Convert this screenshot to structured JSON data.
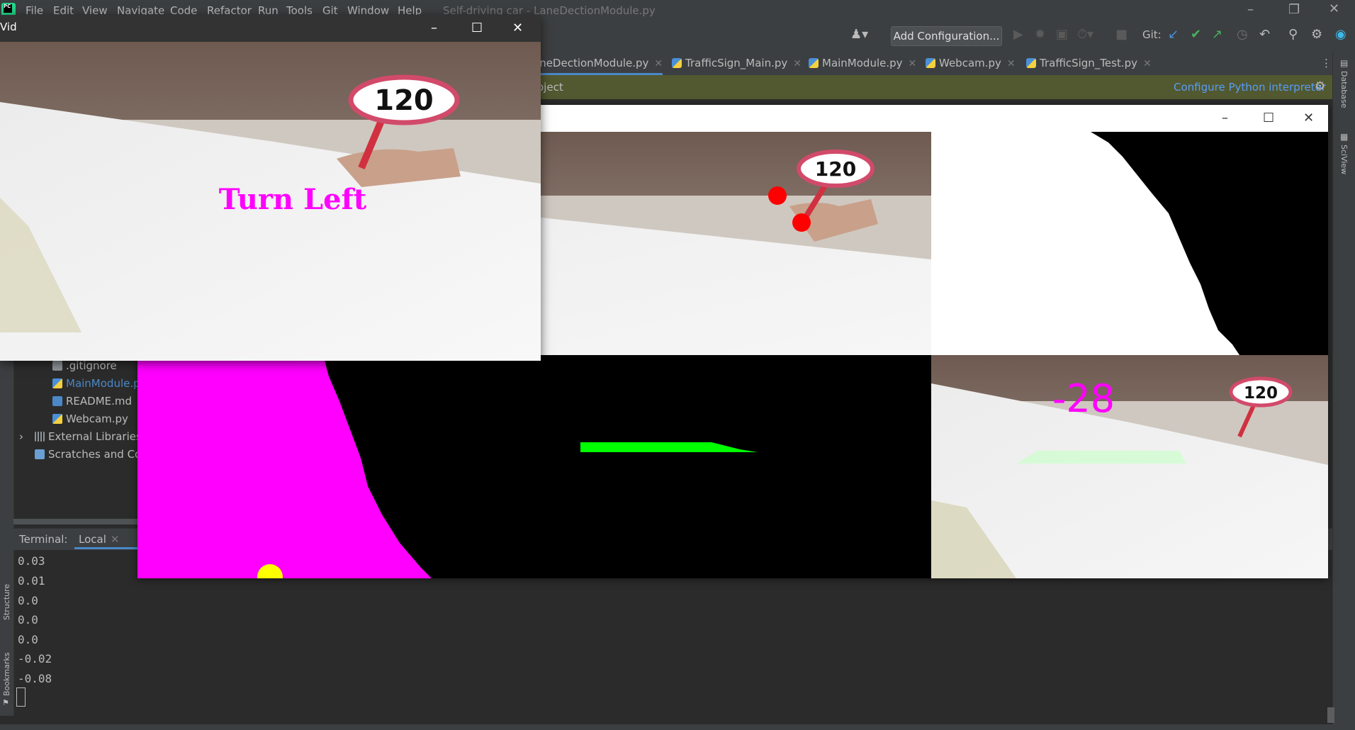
{
  "ide": {
    "logo_text": "PC",
    "menu": [
      "File",
      "Edit",
      "View",
      "Navigate",
      "Code",
      "Refactor",
      "Run",
      "Tools",
      "Git",
      "Window",
      "Help"
    ],
    "title": "Self-driving car - LaneDectionModule.py",
    "window_controls": [
      "minimize-icon",
      "restore-icon",
      "close-icon"
    ]
  },
  "toolbar": {
    "add_config_label": "Add Configuration...",
    "git_label": "Git:"
  },
  "tabs": [
    {
      "label": "aneDectionModule.py",
      "active": true
    },
    {
      "label": "TrafficSign_Main.py",
      "active": false
    },
    {
      "label": "MainModule.py",
      "active": false
    },
    {
      "label": "Webcam.py",
      "active": false
    },
    {
      "label": "TrafficSign_Test.py",
      "active": false
    }
  ],
  "notice": {
    "left_text": "oject",
    "configure_label": "Configure Python interpreter"
  },
  "right_strip": {
    "labels": [
      "Database",
      "SciView"
    ]
  },
  "left_strip": {
    "labels": [
      "Structure",
      "Bookmarks"
    ]
  },
  "project_tree": [
    {
      "label": ".gitignore",
      "icon": "text-file-icon"
    },
    {
      "label": "MainModule.py",
      "icon": "python-file-icon",
      "highlighted": true
    },
    {
      "label": "README.md",
      "icon": "markdown-file-icon"
    },
    {
      "label": "Webcam.py",
      "icon": "python-file-icon"
    },
    {
      "label": "External Libraries",
      "icon": "library-icon",
      "expandable": true
    },
    {
      "label": "Scratches and Consoles",
      "icon": "scratch-icon"
    }
  ],
  "terminal": {
    "title": "Terminal:",
    "tab_label": "Local",
    "output": [
      "0.03",
      "0.01",
      "0.0",
      "0.0",
      "0.0",
      "-0.02",
      "-0.08"
    ]
  },
  "vid_window": {
    "title": "Vid",
    "overlay_text": "Turn Left",
    "sign_text": "120"
  },
  "stack_window": {
    "curve_text": "-28",
    "sign_text": "120",
    "colors": {
      "points": "#ff0000",
      "hist": "#ff00ff",
      "lane": "#00ff00",
      "center": "#ffff00"
    }
  }
}
